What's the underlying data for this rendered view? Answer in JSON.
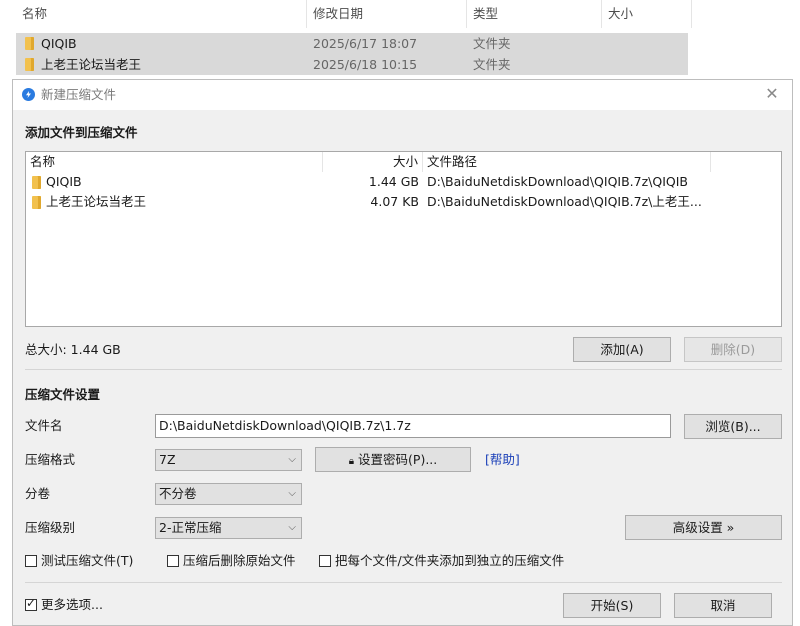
{
  "explorer": {
    "columns": [
      "名称",
      "修改日期",
      "类型",
      "大小"
    ],
    "rows": [
      {
        "name": "QIQIB",
        "date": "2025/6/17 18:07",
        "type": "文件夹"
      },
      {
        "name": "上老王论坛当老王",
        "date": "2025/6/18 10:15",
        "type": "文件夹"
      }
    ]
  },
  "dialog": {
    "title": "新建压缩文件",
    "close": "✕",
    "add_section": "添加文件到压缩文件",
    "list": {
      "headers": {
        "name": "名称",
        "size": "大小",
        "path": "文件路径"
      },
      "rows": [
        {
          "name": "QIQIB",
          "size": "1.44 GB",
          "path": "D:\\BaiduNetdiskDownload\\QIQIB.7z\\QIQIB"
        },
        {
          "name": "上老王论坛当老王",
          "size": "4.07 KB",
          "path": "D:\\BaiduNetdiskDownload\\QIQIB.7z\\上老王..."
        }
      ]
    },
    "total_size": "总大小: 1.44 GB",
    "add_button": "添加(A)",
    "delete_button": "删除(D)",
    "settings_section": "压缩文件设置",
    "filename_label": "文件名",
    "filename_value": "D:\\BaiduNetdiskDownload\\QIQIB.7z\\1.7z",
    "browse_button": "浏览(B)...",
    "format_label": "压缩格式",
    "format_value": "7Z",
    "password_button": "设置密码(P)...",
    "help_link": "[帮助]",
    "volume_label": "分卷",
    "volume_value": "不分卷",
    "level_label": "压缩级别",
    "level_value": "2-正常压缩",
    "advanced_button": "高级设置 »",
    "options": {
      "test": "测试压缩文件(T)",
      "delete_after": "压缩后删除原始文件",
      "separate": "把每个文件/文件夹添加到独立的压缩文件",
      "more": "更多选项..."
    },
    "start_button": "开始(S)",
    "cancel_button": "取消"
  },
  "icons": {
    "folder": "folder-icon",
    "lock": "lock-icon",
    "app": "app-icon"
  },
  "colors": {
    "folder": "#f2c14e",
    "link": "#1a3fb8",
    "app": "#2a7be0"
  }
}
